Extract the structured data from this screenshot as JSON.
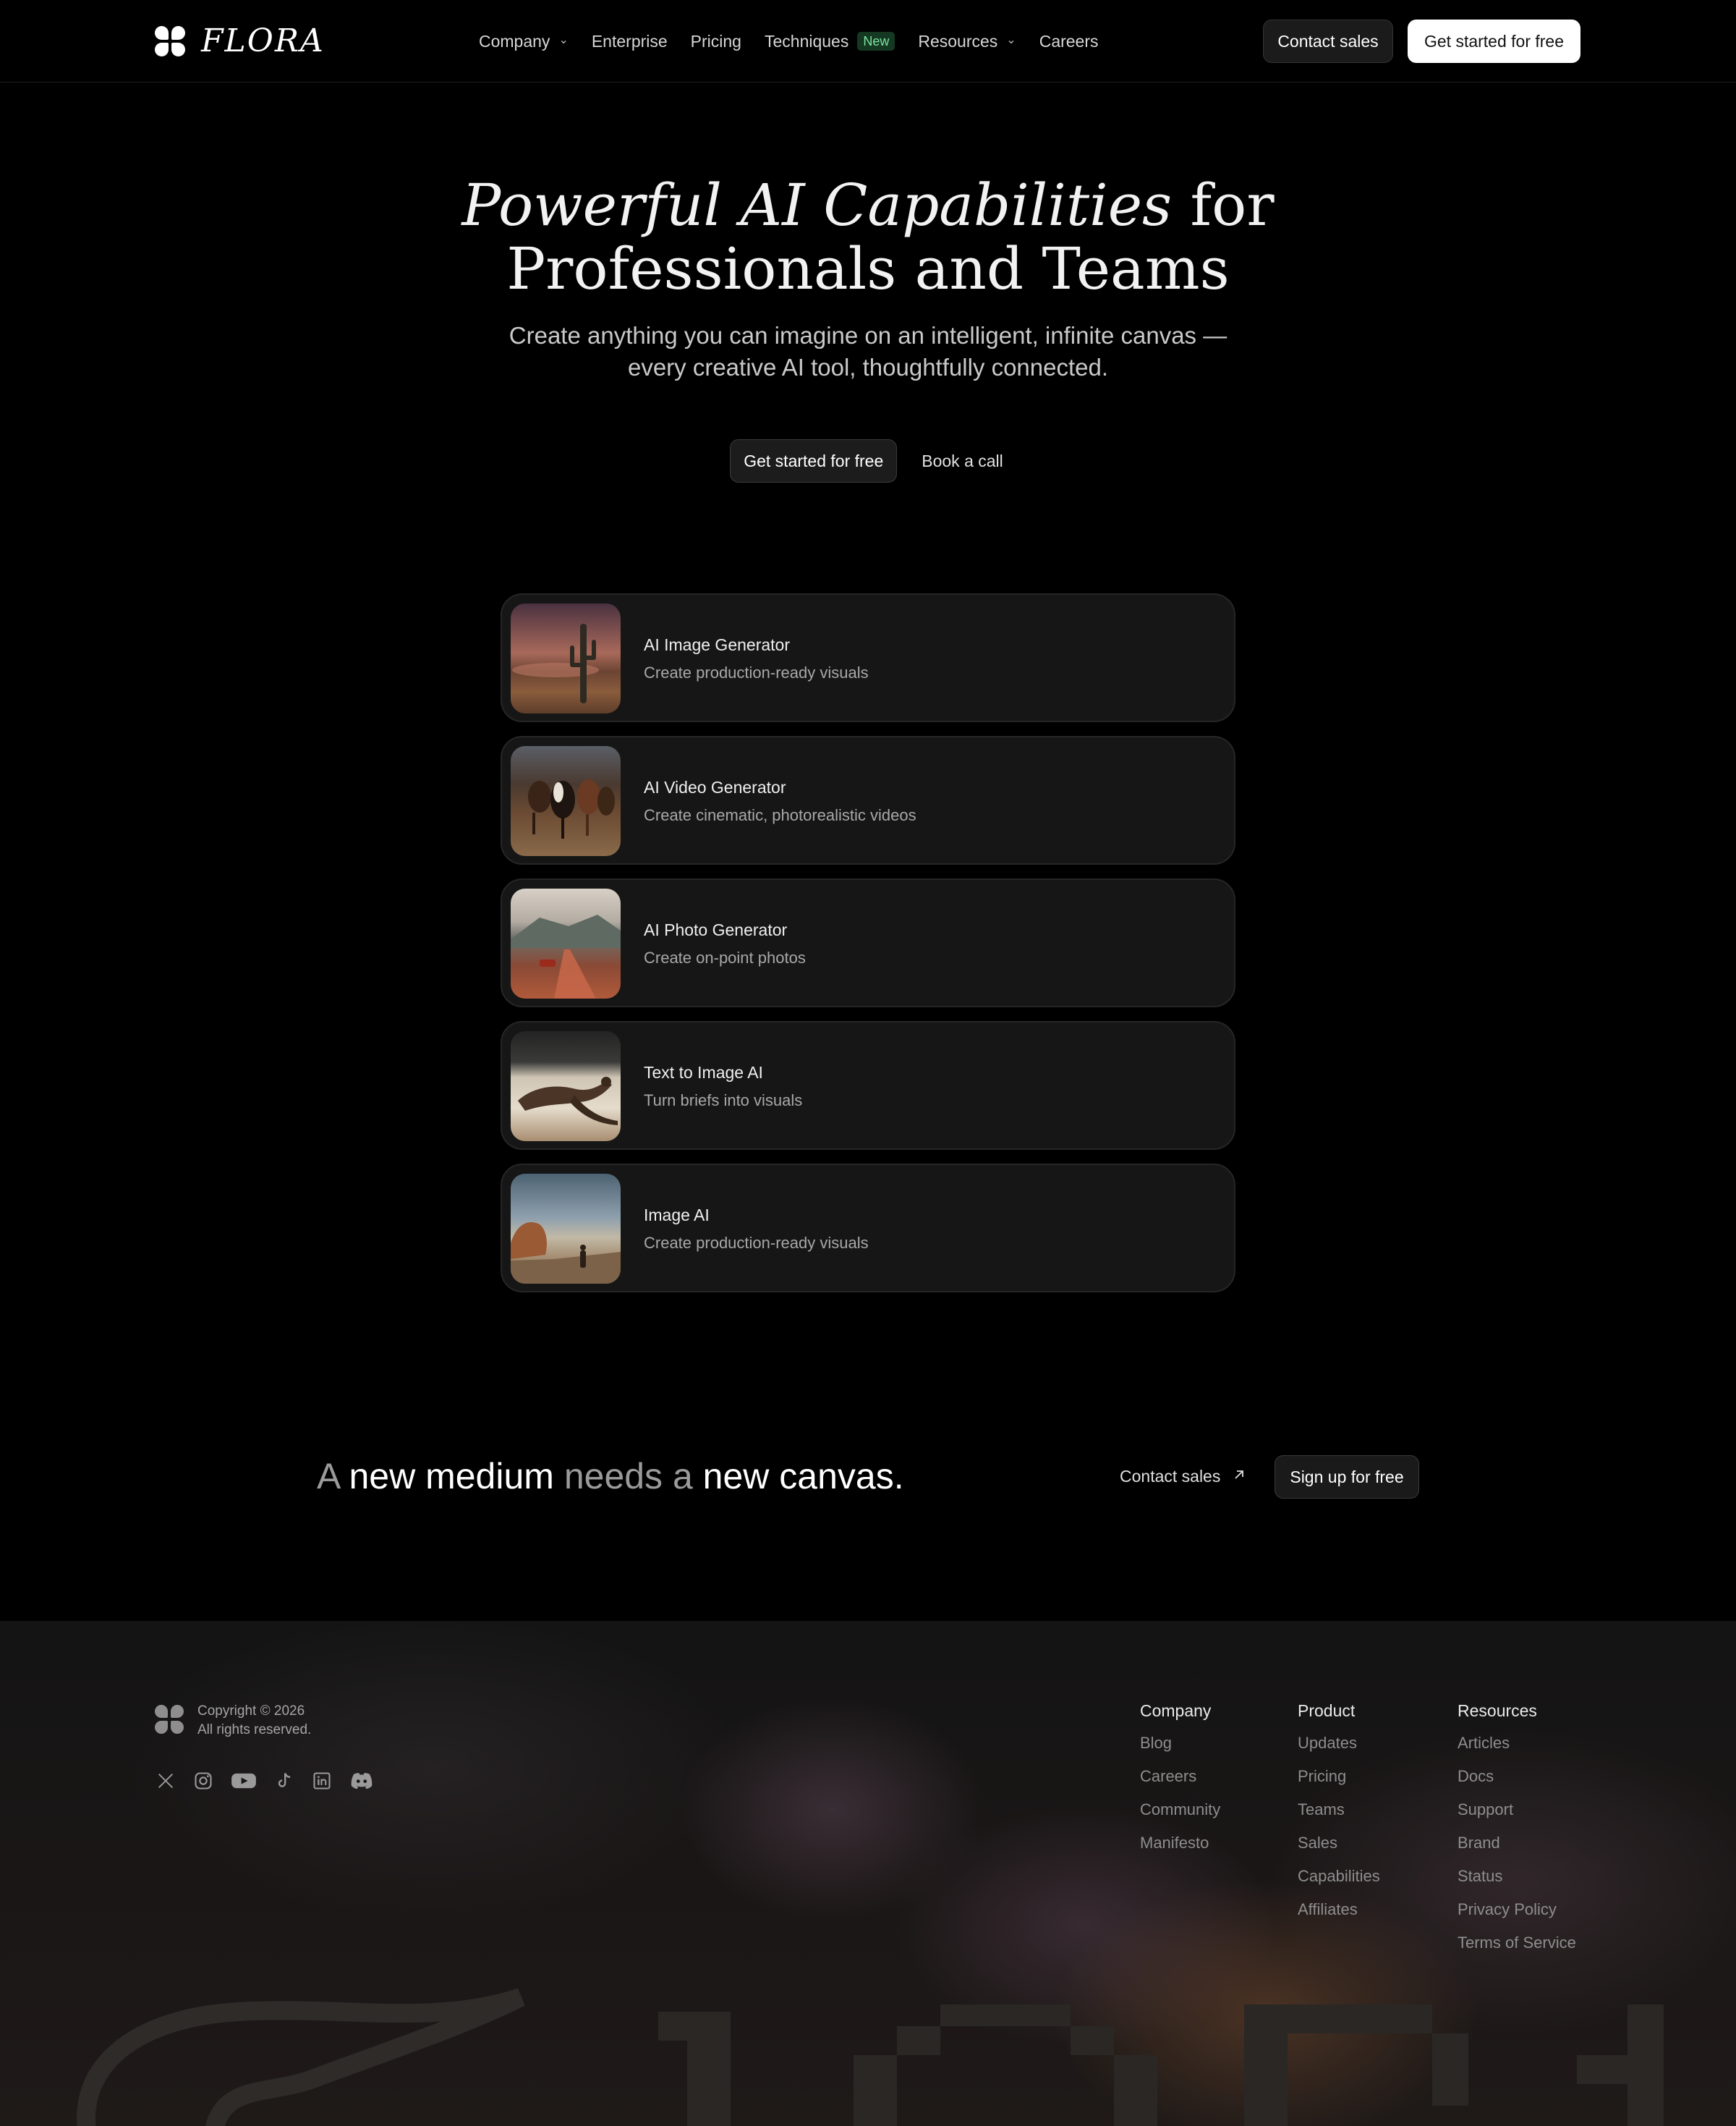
{
  "nav": {
    "brand": "FLORA",
    "links": [
      {
        "label": "Company",
        "has_dropdown": true
      },
      {
        "label": "Enterprise",
        "has_dropdown": false
      },
      {
        "label": "Pricing",
        "has_dropdown": false
      },
      {
        "label": "Techniques",
        "badge": "New"
      },
      {
        "label": "Resources",
        "has_dropdown": true
      },
      {
        "label": "Careers",
        "has_dropdown": false
      }
    ],
    "contact_label": "Contact sales",
    "start_label": "Get started for free"
  },
  "hero": {
    "title_italic": "Powerful AI Capabilities",
    "title_rest_1": " for",
    "title_line_2": "Professionals and Teams",
    "subtitle_line_1": "Create anything you can imagine on an intelligent, infinite canvas —",
    "subtitle_line_2": "every creative AI tool, thoughtfully connected.",
    "primary_label": "Get started for free",
    "secondary_label": "Book a call"
  },
  "tools": [
    {
      "title": "AI Image Generator",
      "description": "Create production-ready visuals",
      "thumb": "desert-cactus-image"
    },
    {
      "title": "AI Video Generator",
      "description": "Create cinematic, photorealistic videos",
      "thumb": "running-horses-image"
    },
    {
      "title": "AI Photo Generator",
      "description": "Create on-point photos",
      "thumb": "desert-road-car-image"
    },
    {
      "title": "Text to Image AI",
      "description": "Turn briefs into visuals",
      "thumb": "kangaroo-image"
    },
    {
      "title": "Image AI",
      "description": "Create production-ready visuals",
      "thumb": "desert-rocks-person-image"
    }
  ],
  "cta": {
    "w1": "A",
    "w2": " new medium ",
    "w3": "needs a",
    "w4": " new canvas.",
    "contact_label": "Contact sales",
    "signup_label": "Sign up for free"
  },
  "footer": {
    "copyright": "Copyright © 2026",
    "rights": "All rights reserved.",
    "socials": [
      "x-icon",
      "instagram-icon",
      "youtube-icon",
      "tiktok-icon",
      "linkedin-icon",
      "discord-icon"
    ],
    "columns": {
      "company": {
        "heading": "Company",
        "links": [
          "Blog",
          "Careers",
          "Community",
          "Manifesto"
        ]
      },
      "product": {
        "heading": "Product",
        "links": [
          "Updates",
          "Pricing",
          "Teams",
          "Sales",
          "Capabilities",
          "Affiliates"
        ]
      },
      "resources": {
        "heading": "Resources",
        "links": [
          "Articles",
          "Docs",
          "Support",
          "Brand",
          "Status",
          "Privacy Policy",
          "Terms of Service"
        ]
      }
    }
  },
  "colors": {
    "background": "#000000",
    "card": "#161616",
    "badge_bg": "#143821",
    "badge_text": "#7ee2a0"
  }
}
